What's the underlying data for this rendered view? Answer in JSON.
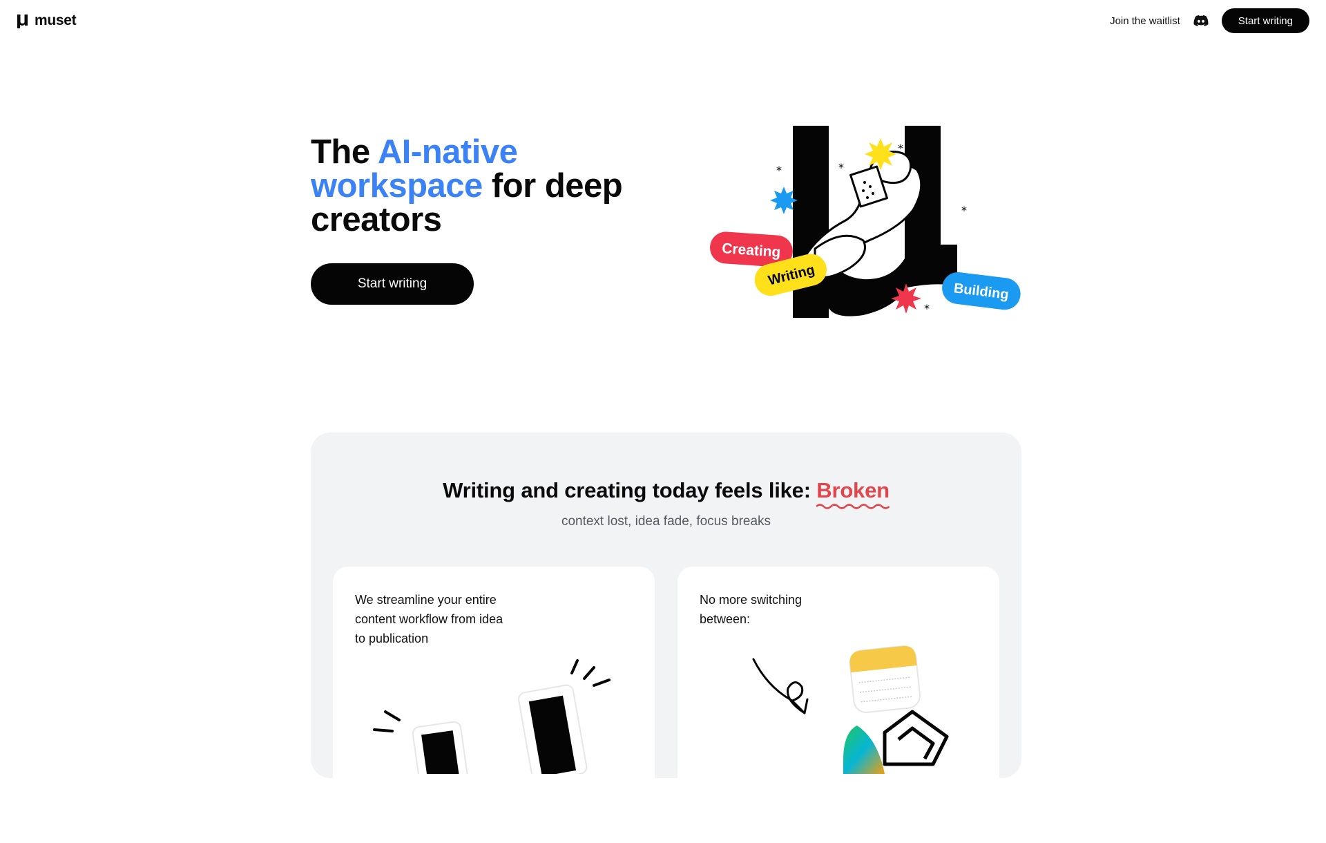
{
  "nav": {
    "brand": "muset",
    "waitlist_label": "Join the waitlist",
    "cta_label": "Start writing"
  },
  "hero": {
    "title_pre": "The ",
    "title_accent": "AI-native workspace",
    "title_post": " for deep creators",
    "cta_label": "Start writing",
    "tags": [
      "Creating",
      "Writing",
      "Building"
    ]
  },
  "problem": {
    "title_prefix": "Writing and creating today feels like: ",
    "title_highlight": "Broken",
    "subtitle": "context lost, idea fade, focus breaks"
  },
  "cards": [
    {
      "text": "We streamline your entire content workflow from idea to publication"
    },
    {
      "text": "No more switching between:"
    }
  ],
  "colors": {
    "accent_blue": "#3b82f6",
    "broken_red": "#e0474c",
    "tag_creating": "#f0364c",
    "tag_writing": "#ffe01a",
    "tag_building": "#1a9af0",
    "panel_bg": "#f2f3f5"
  }
}
